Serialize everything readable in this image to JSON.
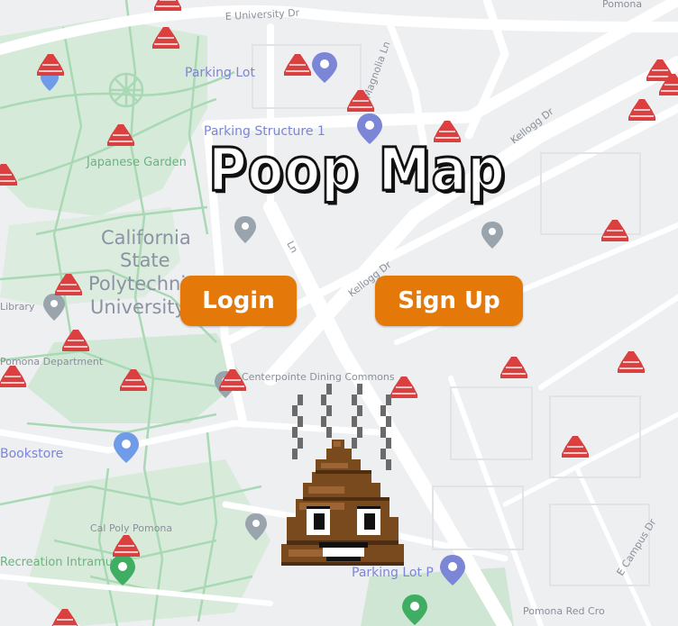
{
  "app": {
    "title": "Poop Map",
    "login_label": "Login",
    "signup_label": "Sign Up",
    "mascot_icon": "pile-of-poo-icon",
    "map_marker_icon": "poop-marker-icon"
  },
  "map": {
    "campus_label": [
      "California",
      "State",
      "Polytechnic",
      "University"
    ],
    "poi_labels": {
      "parking_lot": "Parking Lot",
      "parking_structure": "Parking Structure 1",
      "parking_lot_bottom": "Parking Lot P",
      "japanese_garden": "Japanese Garden",
      "bookstore": "Bookstore",
      "library": "Library",
      "centerpointe": "Centerpointe Dining Commons",
      "recreation": "Recreation Intramural",
      "cal_poly_pomona": "Cal Poly Pomona",
      "pomona_red_cross": "Pomona Red Cro",
      "pomona_top": "Pomona",
      "state_dept": "Pomona Department"
    },
    "street_labels": {
      "university_dr": "E University Dr",
      "kellogg_dr": "Kellogg Dr",
      "kellogg_dr_2": "Kellogg Dr",
      "campus_dr": "E Campus Dr",
      "magnolia": "Magnolia Ln",
      "ln": "Ln"
    },
    "colors": {
      "background": "#eeeff1",
      "road": "#ffffff",
      "park": "#cfe8d3",
      "path": "#a8d8b3",
      "marker": "#d9403f",
      "button": "#e47909"
    }
  }
}
